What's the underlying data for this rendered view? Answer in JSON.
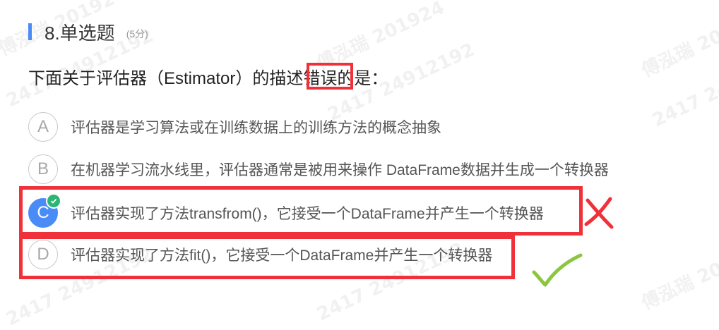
{
  "question": {
    "number_title": "8.单选题",
    "score": "(5分)",
    "stem_before": "下面关于评估器（Estimator）的描述",
    "stem_highlight": "错误",
    "stem_after": "的是：",
    "options": [
      {
        "letter": "A",
        "text": "评估器是学习算法或在训练数据上的训练方法的概念抽象",
        "selected": false
      },
      {
        "letter": "B",
        "text": "在机器学习流水线里，评估器通常是被用来操作 DataFrame数据并生成一个转换器",
        "selected": false
      },
      {
        "letter": "C",
        "text": "评估器实现了方法transfrom()，它接受一个DataFrame并产生一个转换器",
        "selected": true
      },
      {
        "letter": "D",
        "text": "评估器实现了方法fit()，它接受一个DataFrame并产生一个转换器",
        "selected": false
      }
    ]
  },
  "watermark": {
    "name_line": "傅泓瑞 201924",
    "id_line": "2417 24912192"
  },
  "colors": {
    "accent": "#4a8cf7",
    "annotation_red": "#f0313a",
    "check_green": "#2bb673",
    "tick_green": "#8cc63f"
  },
  "annotations": {
    "wrong_mark_icon": "red-x-icon",
    "correct_mark_icon": "green-check-icon"
  }
}
